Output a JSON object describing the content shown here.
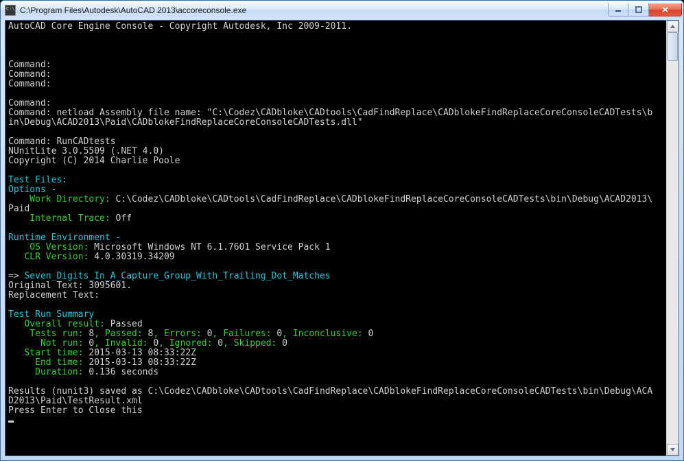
{
  "window": {
    "title": "C:\\Program Files\\Autodesk\\AutoCAD 2013\\accoreconsole.exe"
  },
  "log": {
    "banner": "AutoCAD Core Engine Console - Copyright Autodesk, Inc 2009-2011.",
    "cmd1": "Command:",
    "cmd2": "Command:",
    "cmd3": "Command:",
    "cmd4": "Command:",
    "cmd5": "Command: netload Assembly file name: \"C:\\Codez\\CADbloke\\CADtools\\CadFindReplace\\CADblokeFindReplaceCoreConsoleCADTests\\b\nin\\Debug\\ACAD2013\\Paid\\CADblokeFindReplaceCoreConsoleCADTests.dll\"",
    "cmd6": "Command: RunCADtests",
    "nunit": "NUnitLite 3.0.5509 (.NET 4.0)",
    "copyright": "Copyright (C) 2014 Charlie Poole",
    "testfiles_label": "Test Files:",
    "options_label": "Options -",
    "workdir_label": "    Work Directory: ",
    "workdir_value": "C:\\Codez\\CADbloke\\CADtools\\CadFindReplace\\CADblokeFindReplaceCoreConsoleCADTests\\bin\\Debug\\ACAD2013\\\nPaid",
    "trace_label": "    Internal Trace: ",
    "trace_value": "Off",
    "runtime_label": "Runtime Environment -",
    "os_label": "    OS Version: ",
    "os_value": "Microsoft Windows NT 6.1.7601 Service Pack 1",
    "clr_label": "   CLR Version: ",
    "clr_value": "4.0.30319.34209",
    "arrow": "=> ",
    "testname": "Seven_Digits_In_A_Capture_Group_With_Trailing_Dot_Matches",
    "orig": "Original Text: 3095601.",
    "repl": "Replacement Text:",
    "summary_label": "Test Run Summary",
    "overall_label": "   Overall result: ",
    "overall_value": "Passed",
    "run_l1": "    Tests run: ",
    "run_v1": "8",
    "pass_l": ", Passed: ",
    "pass_v": "8",
    "err_l": ", Errors: ",
    "err_v": "0",
    "fail_l": ", Failures: ",
    "fail_v": "0",
    "inc_l": ", Inconclusive: ",
    "inc_v": "0",
    "not_l": "      Not run: ",
    "not_v": "0",
    "inv_l": ", Invalid: ",
    "inv_v": "0",
    "ign_l": ", Ignored: ",
    "ign_v": "0",
    "skp_l": ", Skipped: ",
    "skp_v": "0",
    "start_l": "   Start time: ",
    "start_v": "2015-03-13 08:33:22Z",
    "end_l": "     End time: ",
    "end_v": "2015-03-13 08:33:22Z",
    "dur_l": "     Duration: ",
    "dur_v": "0.136 seconds",
    "results": "Results (nunit3) saved as C:\\Codez\\CADbloke\\CADtools\\CadFindReplace\\CADblokeFindReplaceCoreConsoleCADTests\\bin\\Debug\\ACA\nD2013\\Paid\\TestResult.xml",
    "press": "Press Enter to Close this"
  }
}
